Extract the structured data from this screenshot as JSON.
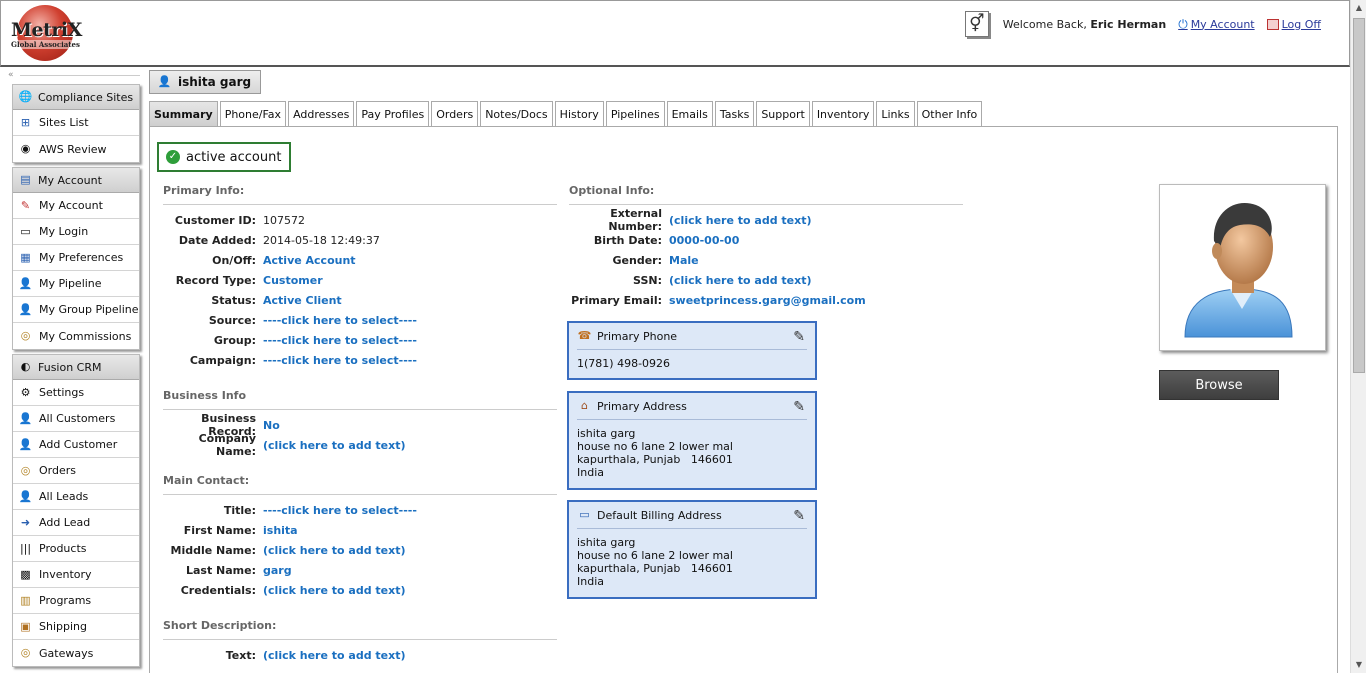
{
  "header": {
    "logo_text": "MetriX",
    "logo_sub": "Global Associates",
    "welcome_prefix": "Welcome Back,",
    "user_name": "Eric Herman",
    "my_account_link": "My Account",
    "logoff_link": "Log Off"
  },
  "sidebar": {
    "groups": [
      {
        "head": "Compliance Sites",
        "items": [
          "Sites List",
          "AWS Review"
        ]
      },
      {
        "head": "My Account",
        "items": [
          "My Account",
          "My Login",
          "My Preferences",
          "My Pipeline",
          "My Group Pipeline",
          "My Commissions"
        ]
      },
      {
        "head": "Fusion CRM",
        "items": [
          "Settings",
          "All Customers",
          "Add Customer",
          "Orders",
          "All Leads",
          "Add Lead",
          "Products",
          "Inventory",
          "Programs",
          "Shipping",
          "Gateways"
        ]
      }
    ]
  },
  "record": {
    "name": "ishita garg"
  },
  "tabs": [
    "Summary",
    "Phone/Fax",
    "Addresses",
    "Pay Profiles",
    "Orders",
    "Notes/Docs",
    "History",
    "Pipelines",
    "Emails",
    "Tasks",
    "Support",
    "Inventory",
    "Links",
    "Other Info"
  ],
  "status_badge": "active account",
  "primary_info": {
    "title": "Primary Info:",
    "fields": [
      {
        "label": "Customer ID:",
        "value": "107572"
      },
      {
        "label": "Date Added:",
        "value": "2014-05-18 12:49:37"
      },
      {
        "label": "On/Off:",
        "value": "Active Account"
      },
      {
        "label": "Record Type:",
        "value": "Customer"
      },
      {
        "label": "Status:",
        "value": "Active Client"
      },
      {
        "label": "Source:",
        "value": "----click here to select----"
      },
      {
        "label": "Group:",
        "value": "----click here to select----"
      },
      {
        "label": "Campaign:",
        "value": "----click here to select----"
      }
    ]
  },
  "business_info": {
    "title": "Business Info",
    "fields": [
      {
        "label": "Business Record:",
        "value": "No"
      },
      {
        "label": "Company Name:",
        "value": "(click here to add text)"
      }
    ]
  },
  "main_contact": {
    "title": "Main Contact:",
    "fields": [
      {
        "label": "Title:",
        "value": "----click here to select----"
      },
      {
        "label": "First Name:",
        "value": "ishita"
      },
      {
        "label": "Middle Name:",
        "value": "(click here to add text)"
      },
      {
        "label": "Last Name:",
        "value": "garg"
      },
      {
        "label": "Credentials:",
        "value": "(click here to add text)"
      }
    ]
  },
  "short_description": {
    "title": "Short Description:",
    "fields": [
      {
        "label": "Text:",
        "value": "(click here to add text)"
      }
    ]
  },
  "optional_info": {
    "title": "Optional Info:",
    "fields": [
      {
        "label": "External Number:",
        "value": "(click here to add text)"
      },
      {
        "label": "Birth Date:",
        "value": "0000-00-00"
      },
      {
        "label": "Gender:",
        "value": "Male"
      },
      {
        "label": "SSN:",
        "value": "(click here to add text)"
      },
      {
        "label": "Primary Email:",
        "value": "sweetprincess.garg@gmail.com"
      }
    ]
  },
  "primary_phone": {
    "title": "Primary Phone",
    "value": "1(781) 498-0926"
  },
  "primary_address": {
    "title": "Primary Address",
    "lines": [
      "ishita garg",
      "house no 6 lane 2 lower mal",
      "kapurthala, Punjab   146601",
      "India"
    ]
  },
  "billing_address": {
    "title": "Default Billing Address",
    "lines": [
      "ishita garg",
      "house no 6 lane 2 lower mal",
      "kapurthala, Punjab   146601",
      "India"
    ]
  },
  "browse_button": "Browse",
  "colors": {
    "link": "#1a6fc0",
    "active_badge_border": "#2e7d32",
    "info_box_bg": "#dde8f7",
    "info_box_border": "#3a6dc0"
  }
}
